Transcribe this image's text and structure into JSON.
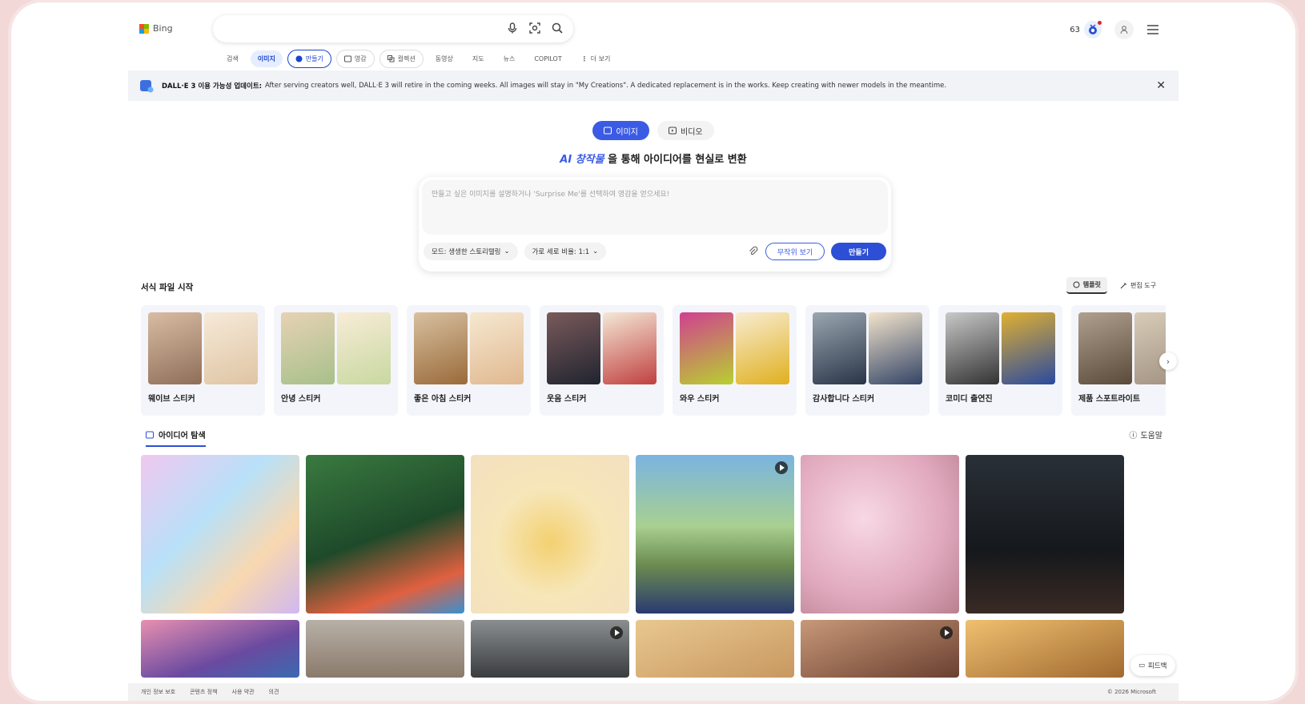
{
  "header": {
    "logo_text": "Bing",
    "points": "63",
    "search_value": ""
  },
  "nav": [
    {
      "label": "검색"
    },
    {
      "label": "이미지"
    },
    {
      "label": "만들기"
    },
    {
      "label": "영감"
    },
    {
      "label": "컬렉션"
    },
    {
      "label": "동영상"
    },
    {
      "label": "지도"
    },
    {
      "label": "뉴스"
    },
    {
      "label": "COPILOT"
    },
    {
      "label": "더 보기"
    }
  ],
  "banner": {
    "title": "DALL·E 3 이용 가능성 업데이트:",
    "text": "After serving creators well, DALL·E 3 will retire in the coming weeks. All images will stay in \"My Creations\". A dedicated replacement is in the works. Keep creating with newer models in the meantime."
  },
  "modes": {
    "image": "이미지",
    "video": "비디오"
  },
  "headline": {
    "accent": "AI 창작물",
    "rest": "을 통해 아이디어를 현실로 변환"
  },
  "prompt": {
    "placeholder": "만들고 싶은 이미지를 설명하거나 'Surprise Me'를 선택하여 영감을 얻으세요!",
    "mode_label": "모드: 생생한 스토리텔링",
    "ratio_label": "가로 세로 비율: 1:1",
    "random_button": "무작위 보기",
    "create_button": "만들기"
  },
  "templates": {
    "title": "서식 파일 시작",
    "tab_templates": "템플릿",
    "tab_edit": "편집 도구",
    "items": [
      {
        "label": "웨이브 스티커",
        "colors": [
          "#c7a58a",
          "#f0e0d0"
        ]
      },
      {
        "label": "안녕 스티커",
        "colors": [
          "#d9c09a",
          "#f4e6cf"
        ]
      },
      {
        "label": "좋은 아침 스티커",
        "colors": [
          "#c9a070",
          "#efe0c8"
        ]
      },
      {
        "label": "웃음 스티커",
        "colors": [
          "#4a3c3c",
          "#f2e3cf"
        ]
      },
      {
        "label": "와우 스티커",
        "colors": [
          "#b73a7a",
          "#f4e6c4"
        ]
      },
      {
        "label": "감사합니다 스티커",
        "colors": [
          "#5d6d80",
          "#f0dfc8"
        ]
      },
      {
        "label": "코미디 출연진",
        "colors": [
          "#8a8a8a",
          "#3a5aa0"
        ]
      },
      {
        "label": "제품 스포트라이트",
        "colors": [
          "#7a6a5a",
          "#cfc0aa"
        ]
      }
    ]
  },
  "explore": {
    "title": "아이디어 탐색",
    "help": "도움말"
  },
  "feedback": "피드백",
  "footer": {
    "links": [
      "개인 정보 보호",
      "콘텐츠 정책",
      "사용 약관",
      "의견"
    ],
    "copyright": "© 2026 Microsoft"
  }
}
